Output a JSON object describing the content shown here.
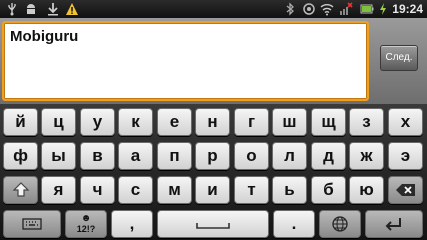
{
  "status_bar": {
    "time": "19:24",
    "icons_left": [
      "usb-icon",
      "android-debug-icon",
      "warning-icon"
    ],
    "icons_right": [
      "bluetooth-icon",
      "sync-icon",
      "wifi-icon",
      "no-signal-icon",
      "battery-icon"
    ]
  },
  "input": {
    "value": "Mobiguru",
    "next_label": "След."
  },
  "keyboard": {
    "row1": [
      "й",
      "ц",
      "у",
      "к",
      "е",
      "н",
      "г",
      "ш",
      "щ",
      "з",
      "х"
    ],
    "row2": [
      "ф",
      "ы",
      "в",
      "а",
      "п",
      "р",
      "о",
      "л",
      "д",
      "ж",
      "э"
    ],
    "row3": [
      "я",
      "ч",
      "с",
      "м",
      "и",
      "т",
      "ь",
      "б",
      "ю"
    ],
    "symbols_label": "12!?",
    "comma": ",",
    "period": "."
  },
  "colors": {
    "focus_border": "#f0a020",
    "key_face": "#e6e6e6",
    "function_key": "#a0a0a0"
  }
}
